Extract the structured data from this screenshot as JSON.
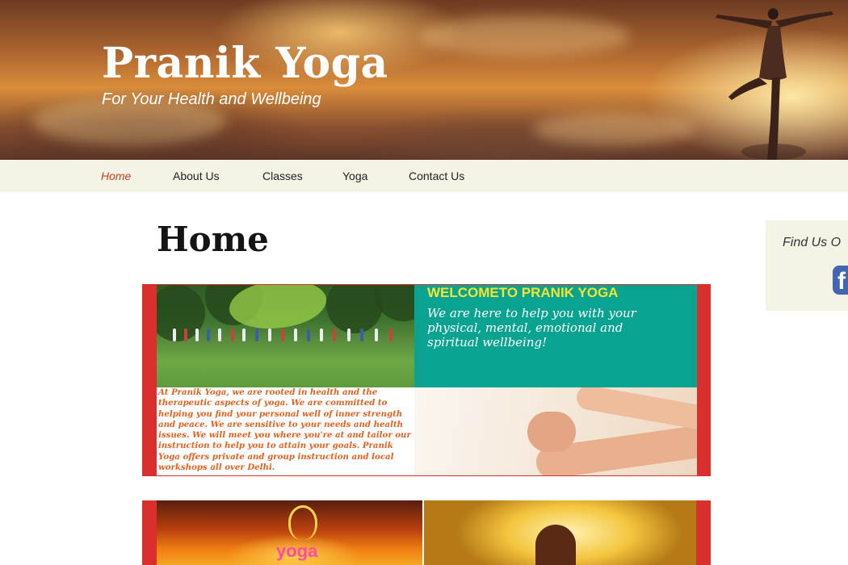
{
  "site": {
    "title": "Pranik Yoga",
    "tagline": "For Your Health and Wellbeing"
  },
  "nav": {
    "items": [
      {
        "label": "Home",
        "active": true
      },
      {
        "label": "About Us",
        "active": false
      },
      {
        "label": "Classes",
        "active": false
      },
      {
        "label": "Yoga",
        "active": false
      },
      {
        "label": "Contact Us",
        "active": false
      }
    ]
  },
  "main": {
    "page_title": "Home",
    "feature": {
      "welcome_title": "WELCOMETO PRANIK YOGA",
      "welcome_text": "We are here to help you with your physical, mental, emotional and spiritual wellbeing!",
      "intro_text": "At Pranik Yoga, we are rooted in health and the therapeutic aspects of yoga. We are committed to helping you find your personal well of inner strength and peace. We are sensitive to your needs and health issues. We will meet you where you're at and tailor our instruction to help you to attain your goals. Pranik Yoga offers private and group instruction and local workshops all over Delhi."
    },
    "feature2": {
      "logo_word": "yoga"
    }
  },
  "sidebar": {
    "widget_title": "Find Us O",
    "facebook_icon": "facebook-icon"
  },
  "colors": {
    "accent": "#c5421a",
    "nav_bg": "#f5f2e6",
    "feature_border": "#d9302e",
    "welcome_bg": "#0aa391",
    "welcome_title": "#f3e531",
    "intro_text": "#e3621f"
  }
}
